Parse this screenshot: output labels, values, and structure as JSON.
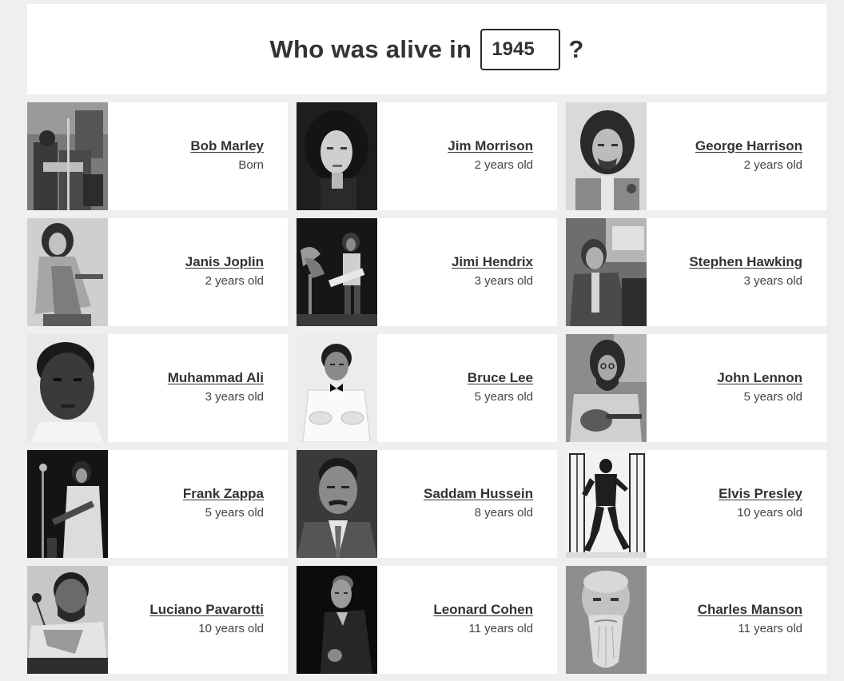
{
  "header": {
    "question_prefix": "Who was alive in",
    "year_value": "1945",
    "question_suffix": "?"
  },
  "people": [
    {
      "name": "Bob Marley",
      "age": "Born"
    },
    {
      "name": "Jim Morrison",
      "age": "2 years old"
    },
    {
      "name": "George Harrison",
      "age": "2 years old"
    },
    {
      "name": "Janis Joplin",
      "age": "2 years old"
    },
    {
      "name": "Jimi Hendrix",
      "age": "3 years old"
    },
    {
      "name": "Stephen Hawking",
      "age": "3 years old"
    },
    {
      "name": "Muhammad Ali",
      "age": "3 years old"
    },
    {
      "name": "Bruce Lee",
      "age": "5 years old"
    },
    {
      "name": "John Lennon",
      "age": "5 years old"
    },
    {
      "name": "Frank Zappa",
      "age": "5 years old"
    },
    {
      "name": "Saddam Hussein",
      "age": "8 years old"
    },
    {
      "name": "Elvis Presley",
      "age": "10 years old"
    },
    {
      "name": "Luciano Pavarotti",
      "age": "10 years old"
    },
    {
      "name": "Leonard Cohen",
      "age": "11 years old"
    },
    {
      "name": "Charles Manson",
      "age": "11 years old"
    }
  ]
}
